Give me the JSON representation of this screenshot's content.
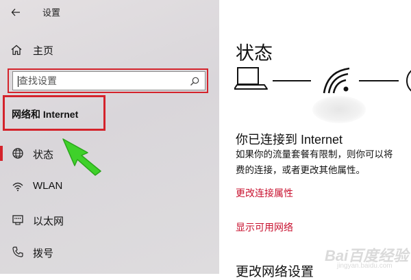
{
  "window": {
    "title": "设置"
  },
  "sidebar": {
    "home_label": "主页",
    "search": {
      "placeholder": "查找设置",
      "value": ""
    },
    "section_title": "网络和 Internet",
    "items": [
      {
        "label": "状态",
        "icon": "globe-icon",
        "selected": true
      },
      {
        "label": "WLAN",
        "icon": "wifi-icon",
        "selected": false
      },
      {
        "label": "以太网",
        "icon": "ethernet-icon",
        "selected": false
      },
      {
        "label": "拨号",
        "icon": "phone-icon",
        "selected": false
      }
    ]
  },
  "main": {
    "title": "状态",
    "connected_title": "你已连接到 Internet",
    "description_lines": [
      "如果你的流量套餐有限制，则你可以将",
      "费的连接，或者更改其他属性。"
    ],
    "links": [
      "更改连接属性",
      "显示可用网络"
    ],
    "section2_title": "更改网络设置"
  },
  "watermark": {
    "brand": "Bai百度经验",
    "sub": "jingyan.baidu.com"
  },
  "colors": {
    "accent": "#d4232b",
    "link": "#c8102e",
    "annotation_arrow": "#3fd12a"
  }
}
